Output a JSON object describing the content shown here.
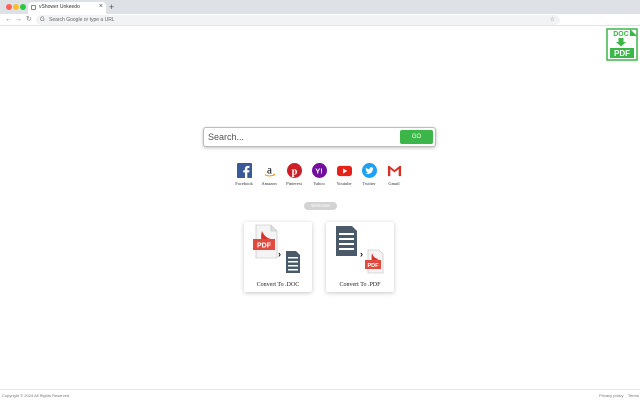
{
  "browser": {
    "tab_title": "vShower Unkeedo",
    "tab_close": "×",
    "new_tab": "+",
    "omnibox_placeholder": "Search Google or type a URL",
    "nav_back": "←",
    "nav_forward": "→",
    "nav_reload": "↻"
  },
  "ext_logo": {
    "doc_text": "DOC",
    "pdf_text": "PDF"
  },
  "search": {
    "placeholder": "Search...",
    "button_label": "GO"
  },
  "shortcuts": [
    {
      "label": "Facebook",
      "icon": "facebook-icon",
      "color": "#3b5998"
    },
    {
      "label": "Amazon",
      "icon": "amazon-icon",
      "color": "#000000"
    },
    {
      "label": "Pinterest",
      "icon": "pinterest-icon",
      "color": "#cb2027"
    },
    {
      "label": "Yahoo",
      "icon": "yahoo-icon",
      "color": "#720e9e"
    },
    {
      "label": "Youtube",
      "icon": "youtube-icon",
      "color": "#e62117"
    },
    {
      "label": "Twitter",
      "icon": "twitter-icon",
      "color": "#1da1f2"
    },
    {
      "label": "Gmail",
      "icon": "gmail-icon",
      "color": "#d93025"
    }
  ],
  "pill_label": "Welcome",
  "cards": [
    {
      "label": "Convert To .DOC",
      "pdf_text": "PDF"
    },
    {
      "label": "Convert To .PDF",
      "pdf_text": "PDF"
    }
  ],
  "footer": {
    "copyright": "Copyright © 2024 All Rights Reserved",
    "privacy": "Privacy policy",
    "terms": "Terms"
  },
  "colors": {
    "accent_green": "#3cb648",
    "pdf_red": "#e04a3f",
    "doc_gray": "#4a5a6a"
  }
}
